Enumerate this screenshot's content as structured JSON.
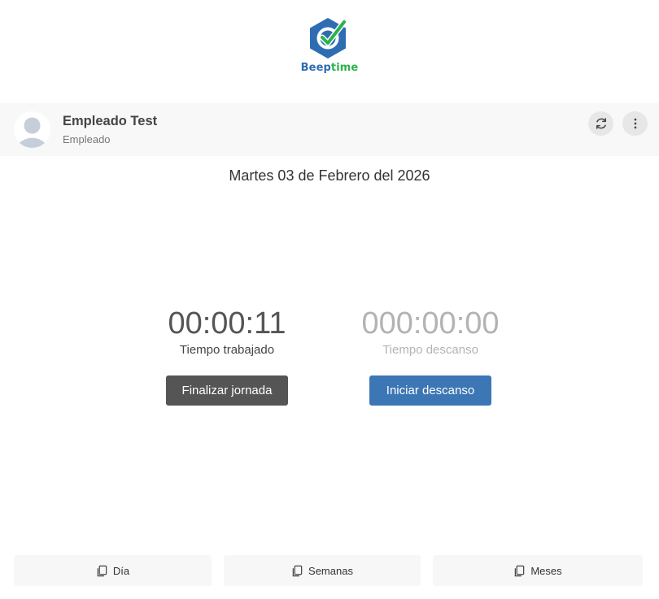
{
  "brand": {
    "name_part1": "Beep",
    "name_part2": "time",
    "primary_color": "#2f6db3",
    "accent_color": "#2bb24c"
  },
  "user": {
    "name": "Empleado Test",
    "role": "Empleado",
    "avatar_icon": "user-avatar-icon"
  },
  "header_actions": {
    "refresh_icon": "refresh-icon",
    "more_icon": "more-vertical-icon"
  },
  "date_text": "Martes 03 de Febrero del 2026",
  "timers": {
    "worked": {
      "value": "00:00:11",
      "label": "Tiempo trabajado"
    },
    "break": {
      "value": "000:00:00",
      "label": "Tiempo descanso"
    }
  },
  "actions": {
    "end_day_label": "Finalizar jornada",
    "end_day_color": "#555555",
    "start_break_label": "Iniciar descanso",
    "start_break_color": "#3c76b5"
  },
  "tabs": [
    {
      "label": "Día",
      "icon": "copy-icon"
    },
    {
      "label": "Semanas",
      "icon": "copy-icon"
    },
    {
      "label": "Meses",
      "icon": "copy-icon"
    }
  ]
}
